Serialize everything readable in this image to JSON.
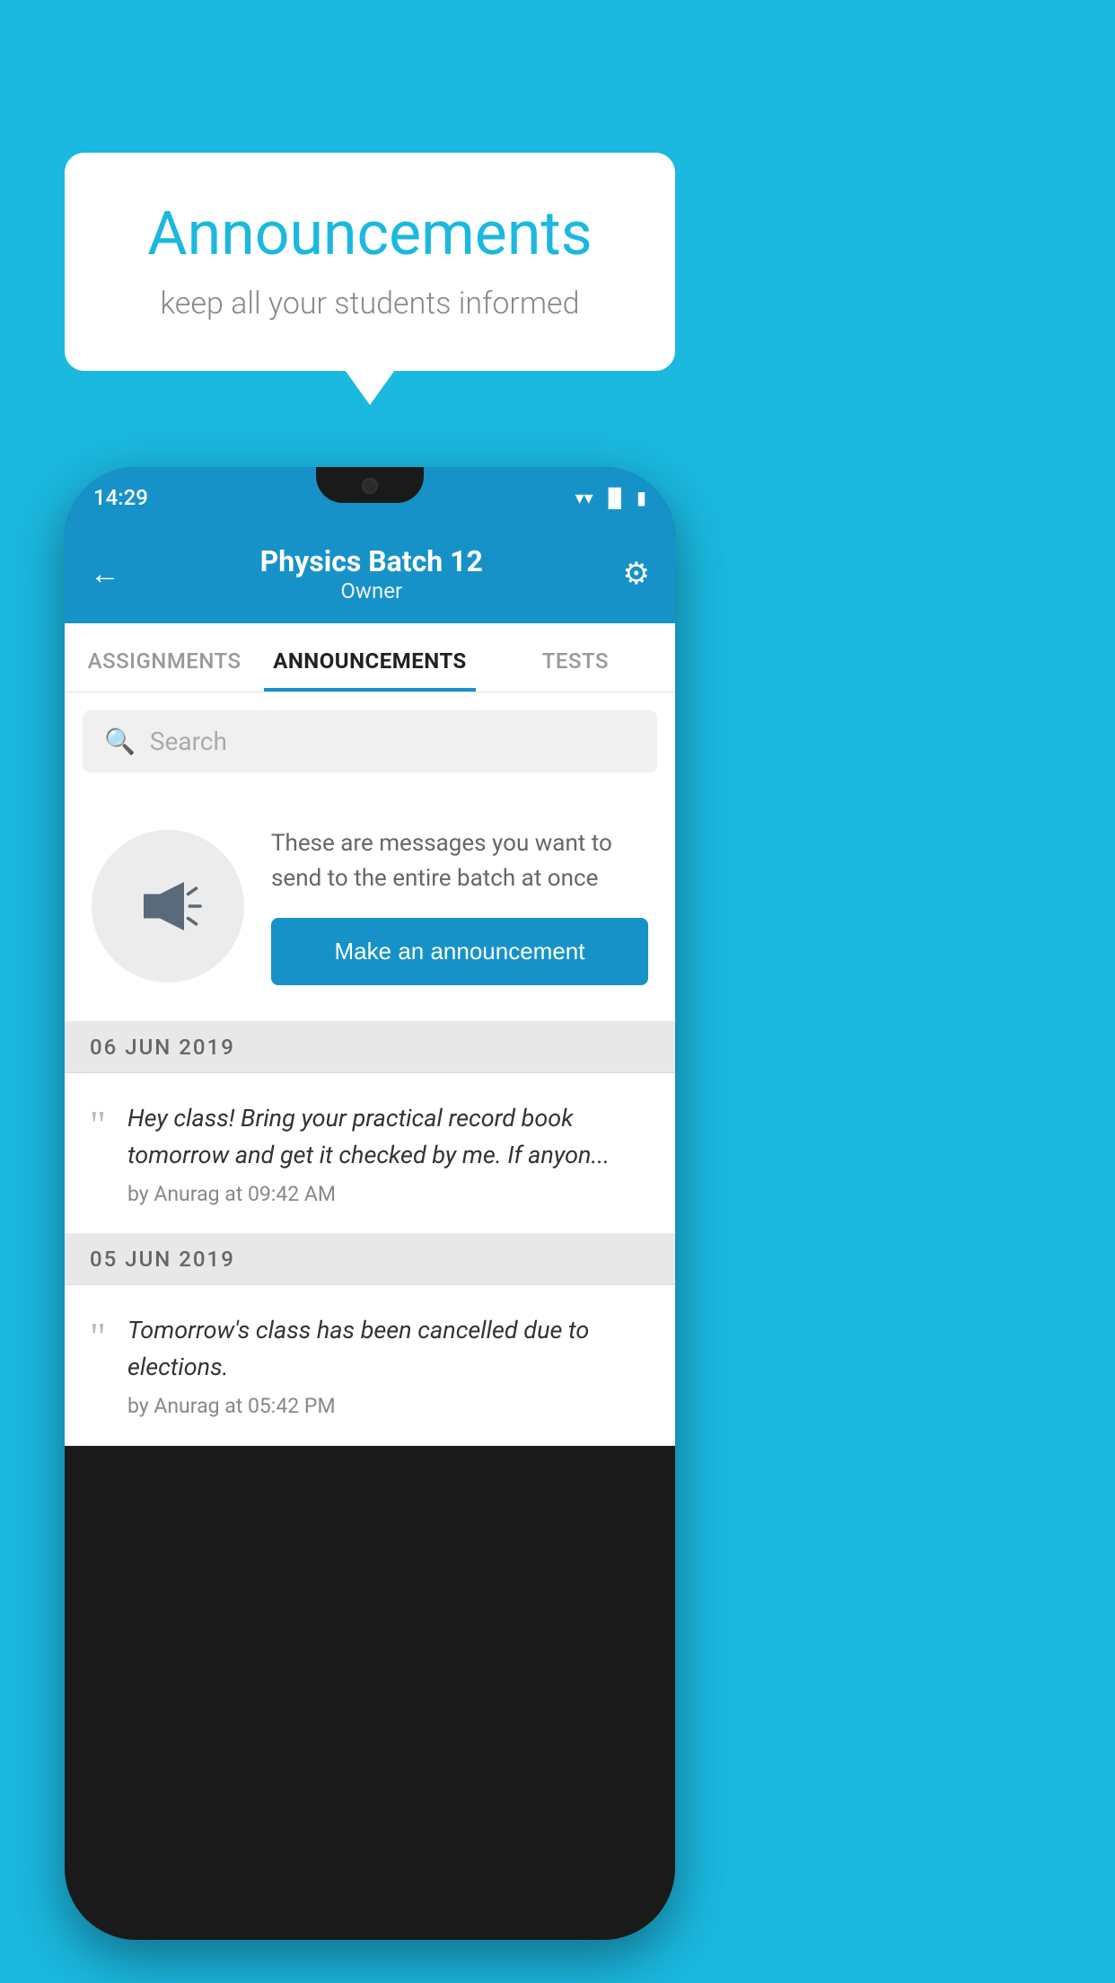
{
  "background_color": "#1bb8e0",
  "speech_bubble": {
    "title": "Announcements",
    "subtitle": "keep all your students informed"
  },
  "phone": {
    "status_bar": {
      "time": "14:29",
      "icons": [
        "wifi",
        "signal",
        "battery"
      ]
    },
    "header": {
      "title": "Physics Batch 12",
      "subtitle": "Owner",
      "back_label": "←",
      "settings_label": "⚙"
    },
    "tabs": [
      {
        "label": "ASSIGNMENTS",
        "active": false
      },
      {
        "label": "ANNOUNCEMENTS",
        "active": true
      },
      {
        "label": "TESTS",
        "active": false
      }
    ],
    "search": {
      "placeholder": "Search"
    },
    "announcement_prompt": {
      "description": "These are messages you want to send to the entire batch at once",
      "button_label": "Make an announcement"
    },
    "announcements": [
      {
        "date": "06  JUN  2019",
        "message": "Hey class! Bring your practical record book tomorrow and get it checked by me. If anyon...",
        "meta": "by Anurag at 09:42 AM"
      },
      {
        "date": "05  JUN  2019",
        "message": "Tomorrow's class has been cancelled due to elections.",
        "meta": "by Anurag at 05:42 PM"
      }
    ]
  }
}
